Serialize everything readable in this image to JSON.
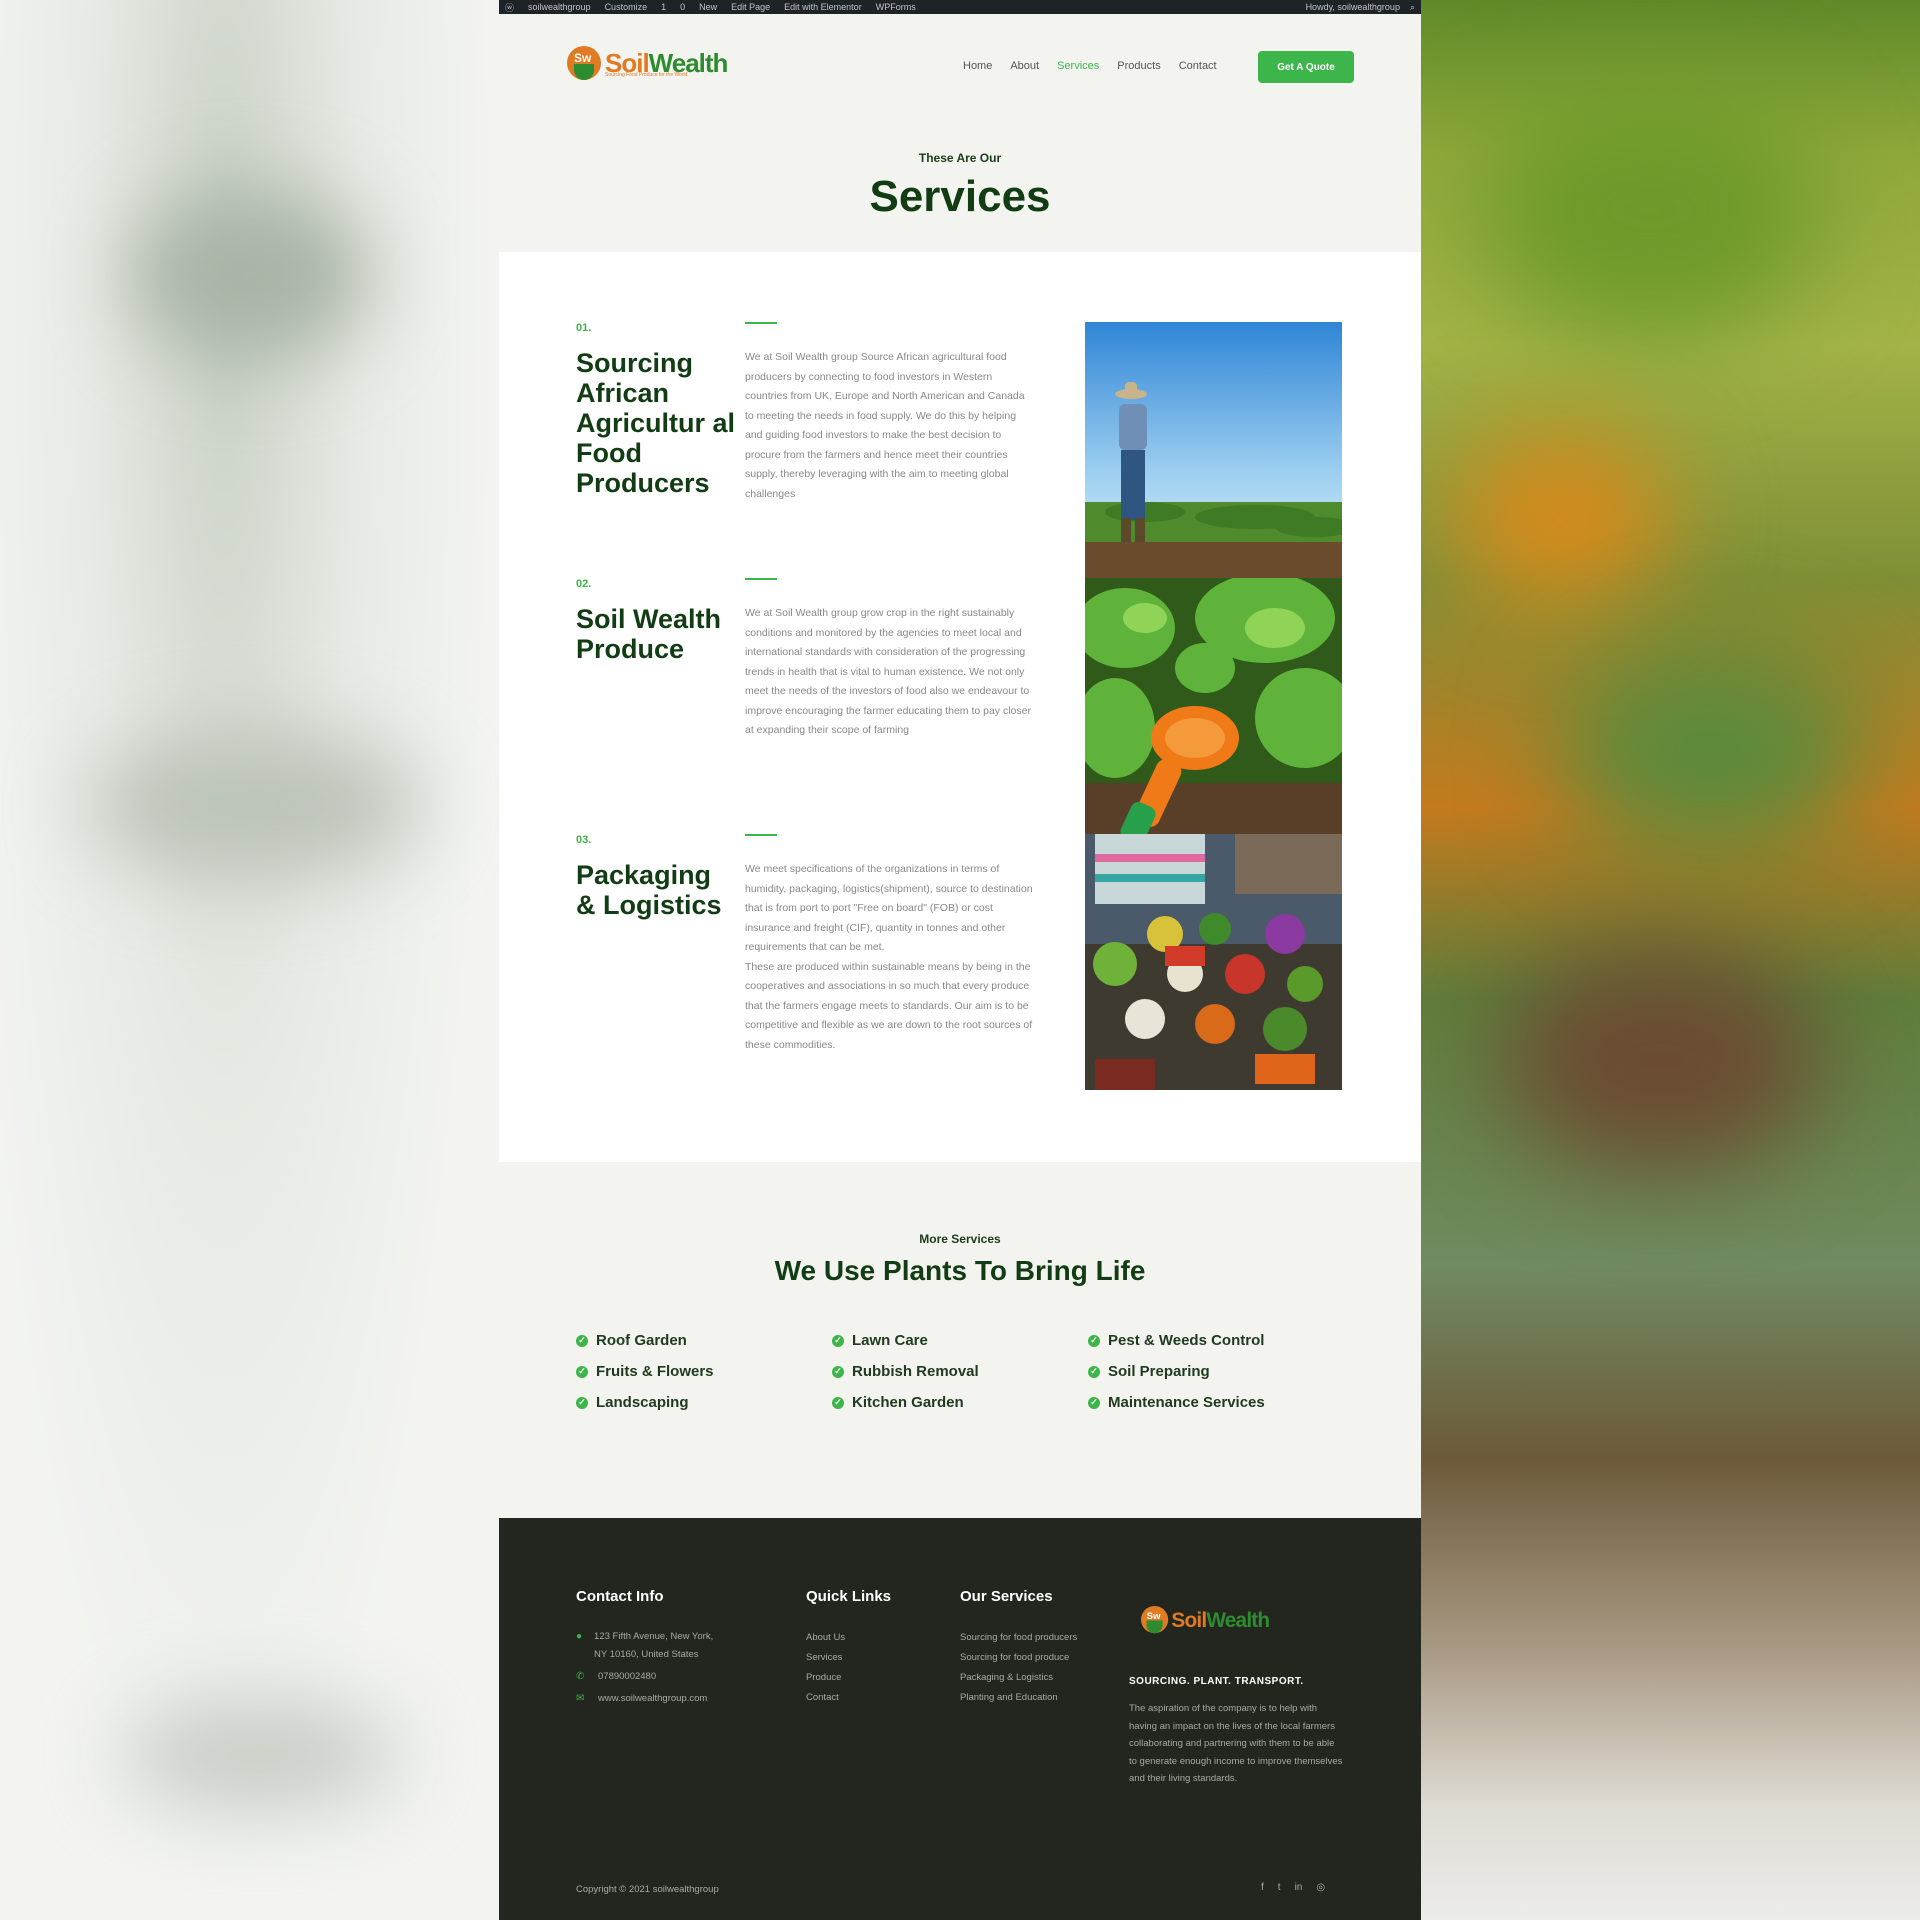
{
  "admin_bar": {
    "items": [
      "soilwealthgroup",
      "Customize",
      "1",
      "0",
      "New",
      "Edit Page",
      "Edit with Elementor",
      "WPForms"
    ],
    "howdy": "Howdy, soilwealthgroup"
  },
  "header": {
    "logo_part1": "Soil",
    "logo_part2": "Wealth",
    "logo_mark": "Sw",
    "logo_tagline": "Sourcing Food Produce for the World",
    "nav": [
      "Home",
      "About",
      "Services",
      "Products",
      "Contact"
    ],
    "active_nav": "Services",
    "cta": "Get A Quote"
  },
  "hero": {
    "pre": "These Are Our",
    "title": "Services"
  },
  "services": [
    {
      "num": "01.",
      "title": "Sourcing African Agricultur al Food Producers",
      "text": "We at Soil Wealth group Source African agricultural food producers by connecting to food investors in Western countries from UK, Europe and North American and Canada to meeting the needs in food supply. We do this by helping and guiding food investors to make the best decision to procure from the farmers and hence meet their countries supply, thereby leveraging with the aim to meeting global challenges"
    },
    {
      "num": "02.",
      "title": "Soil Wealth Produce",
      "text": "We at Soil Wealth group grow crop in the right sustainably conditions and monitored by the agencies to meet local and international standards with consideration of the progressing trends in health that is vital to human existence. We not only meet the needs of the investors of food also we endeavour to improve encouraging the farmer educating them to pay closer at expanding their scope of farming"
    },
    {
      "num": "03.",
      "title": "Packaging & Logistics",
      "text": "We meet specifications of the organizations in terms of humidity, packaging, logistics(shipment), source to destination that is from port to port \"Free on board\" (FOB) or cost insurance and freight (CIF), quantity in tonnes and other requirements that can be met.",
      "text2": "These are produced within sustainable means by being in the cooperatives and associations in so much that every produce that the farmers engage meets to standards. Our aim is to be competitive and flexible as we are down to the root sources of these commodities."
    }
  ],
  "more": {
    "pre": "More Services",
    "title": "We Use Plants To Bring Life",
    "items": [
      "Roof Garden",
      "Lawn Care",
      "Pest & Weeds Control",
      "Fruits & Flowers",
      "Rubbish Removal",
      "Soil Preparing",
      "Landscaping",
      "Kitchen Garden",
      "Maintenance Services"
    ]
  },
  "footer": {
    "contact_heading": "Contact Info",
    "address": "123 Fifth Avenue, New York, NY 10160, United States",
    "phone": "07890002480",
    "website": "www.soilwealthgroup.com",
    "quick_heading": "Quick Links",
    "quick_links": [
      "About Us",
      "Services",
      "Produce",
      "Contact"
    ],
    "services_heading": "Our Services",
    "service_links": [
      "Sourcing for food producers",
      "Sourcing for food produce",
      "Packaging & Logistics",
      "Planting and Education"
    ],
    "tagline": "SOURCING. PLANT. TRANSPORT.",
    "about": "The aspiration of the company is to help with having an impact on the lives of the local farmers collaborating and partnering with them to be able to generate enough income to improve themselves and their living standards.",
    "copyright": "Copyright © 2021 soilwealthgroup",
    "social_icons": [
      "facebook-icon",
      "twitter-icon",
      "linkedin-icon",
      "instagram-icon"
    ]
  },
  "colors": {
    "brand_green": "#3cb54a",
    "dark_green": "#123d14",
    "brand_orange": "#e07b23",
    "footer_bg": "#23251f"
  }
}
